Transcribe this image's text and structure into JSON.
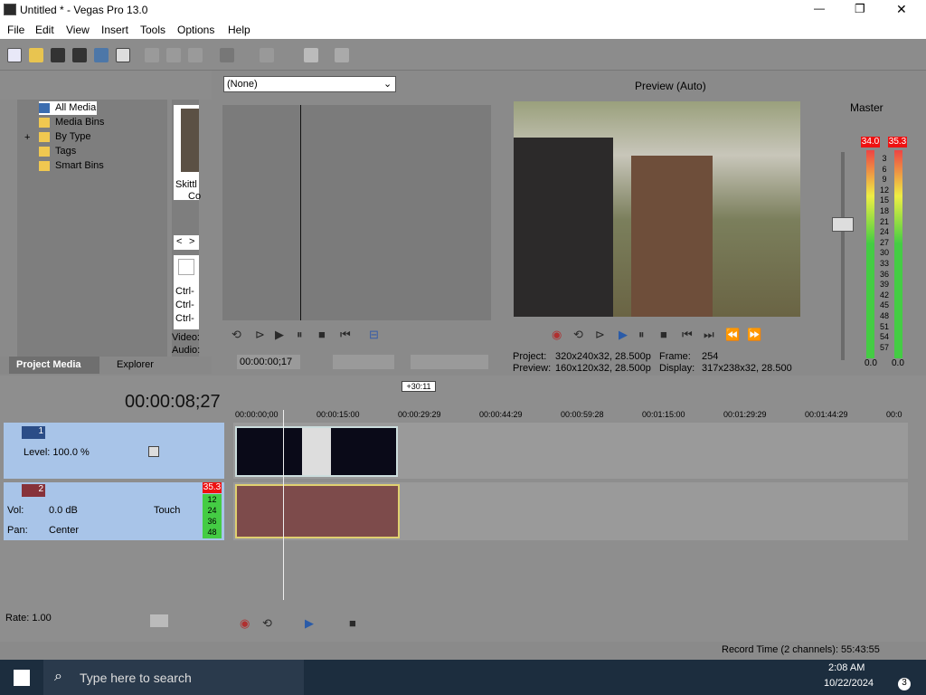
{
  "window": {
    "title": "Untitled * - Vegas Pro 13.0",
    "minimize": "—",
    "maximize": "❐",
    "close": "✕"
  },
  "menu": [
    "File",
    "Edit",
    "View",
    "Insert",
    "Tools",
    "Options",
    "Help"
  ],
  "explorer": {
    "tree": [
      "All Media",
      "Media Bins",
      "By Type",
      "Tags",
      "Smart Bins"
    ],
    "expander": "+",
    "thumb_caption": [
      "Skittl",
      "Co"
    ],
    "nav": [
      "<",
      ">"
    ],
    "shortcuts": [
      "Ctrl-",
      "Ctrl-",
      "Ctrl-"
    ],
    "info": [
      "Video:",
      "Audio:"
    ],
    "tabs": [
      "Project Media",
      "Explorer"
    ]
  },
  "trimmer": {
    "dropdown": "(None)",
    "timecode": "00:00:00;17"
  },
  "preview": {
    "mode": "Preview (Auto)",
    "project_label": "Project:",
    "project_value": "320x240x32, 28.500p",
    "preview_label": "Preview:",
    "preview_value": "160x120x32, 28.500p",
    "frame_label": "Frame:",
    "frame_value": "254",
    "display_label": "Display:",
    "display_value": "317x238x32, 28.500"
  },
  "master": {
    "title": "Master",
    "peak_left": "34.0",
    "peak_right": "35.3",
    "scale": [
      "3",
      "6",
      "9",
      "12",
      "15",
      "18",
      "21",
      "24",
      "27",
      "30",
      "33",
      "36",
      "39",
      "42",
      "45",
      "48",
      "51",
      "54",
      "57"
    ],
    "bottom_left": "0.0",
    "bottom_right": "0.0"
  },
  "timeline": {
    "timecode": "00:00:08;27",
    "length_badge": "+30:11",
    "ruler": [
      "00:00:00;00",
      "00:00:15:00",
      "00:00:29:29",
      "00:00:44:29",
      "00:00:59:28",
      "00:01:15:00",
      "00:01:29:29",
      "00:01:44:29",
      "00:0"
    ]
  },
  "track1": {
    "number": "1",
    "level": "Level: 100.0 %"
  },
  "track2": {
    "number": "2",
    "vol_label": "Vol:",
    "vol_value": "0.0 dB",
    "pan_label": "Pan:",
    "pan_value": "Center",
    "mode": "Touch",
    "peak": "35.3",
    "meter": [
      "12",
      "24",
      "36",
      "48"
    ]
  },
  "transport": {
    "rate": "Rate: 1.00"
  },
  "status": {
    "record_time": "Record Time (2 channels): 55:43:55"
  },
  "taskbar": {
    "search": "Type here to search",
    "time": "2:08 AM",
    "date": "10/22/2024",
    "notif": "3"
  }
}
